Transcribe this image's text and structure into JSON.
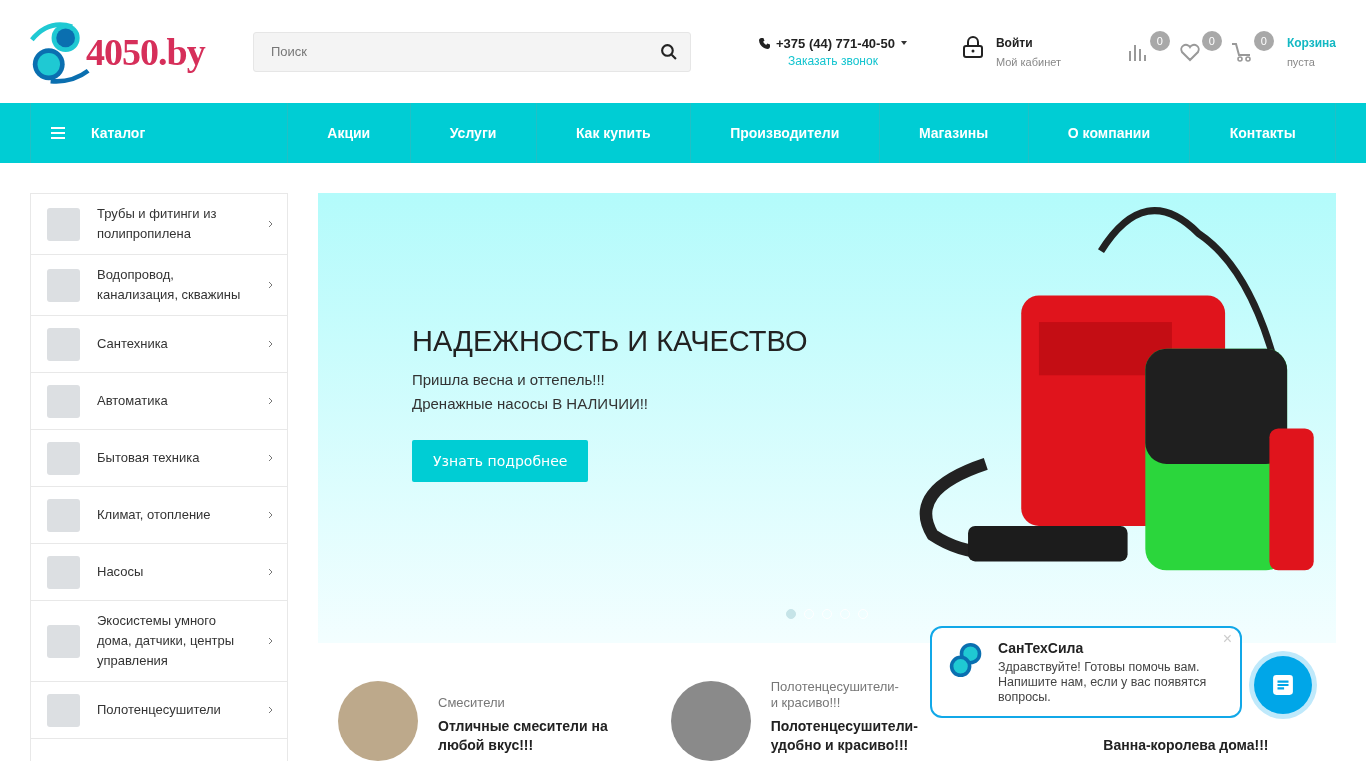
{
  "header": {
    "logo": "4050.by",
    "search": {
      "placeholder": "Поиск"
    },
    "phone": "+375 (44) 771-40-50",
    "callback_link": "Заказать звонок",
    "login": {
      "title": "Войти",
      "subtitle": "Мой кабинет"
    },
    "compare_count": "0",
    "favorites_count": "0",
    "cart": {
      "count": "0",
      "title": "Корзина",
      "subtitle": "пуста"
    }
  },
  "nav": {
    "catalog": "Каталог",
    "items": [
      "Акции",
      "Услуги",
      "Как купить",
      "Производители",
      "Магазины",
      "О компании",
      "Контакты"
    ]
  },
  "sidebar": {
    "items": [
      {
        "label": "Трубы и фитинги из полипропилена"
      },
      {
        "label": "Водопровод, канализация, скважины"
      },
      {
        "label": "Сантехника"
      },
      {
        "label": "Автоматика"
      },
      {
        "label": "Бытовая техника"
      },
      {
        "label": "Климат, отопление"
      },
      {
        "label": "Насосы"
      },
      {
        "label": "Экосистемы умного дома, датчики, центры управления"
      },
      {
        "label": "Полотенцесушители"
      }
    ]
  },
  "banner": {
    "title": "НАДЕЖНОСТЬ И КАЧЕСТВО",
    "text": "Пришла весна и оттепель!!!\nДренажные насосы В НАЛИЧИИ!!",
    "button": "Узнать подробнее",
    "dots": [
      {
        "selected": true
      },
      {
        "selected": false
      },
      {
        "selected": false
      },
      {
        "selected": false
      },
      {
        "selected": false
      }
    ]
  },
  "promos": [
    {
      "photo": true,
      "label": "Смесители",
      "title": "Отличные смесители на любой вкус!!!"
    },
    {
      "photo": true,
      "label": "Полотенцесушители-\nи красиво!!!",
      "title": "Полотенцесушители- удобно и красиво!!!"
    },
    {
      "photo": false,
      "title": "Ванна-королева дома!!!"
    }
  ],
  "chat": {
    "name": "СанТехСила",
    "message": "Здравствуйте! Готовы помочь вам. Напишите нам, если у вас появятся вопросы.",
    "close": "×"
  }
}
